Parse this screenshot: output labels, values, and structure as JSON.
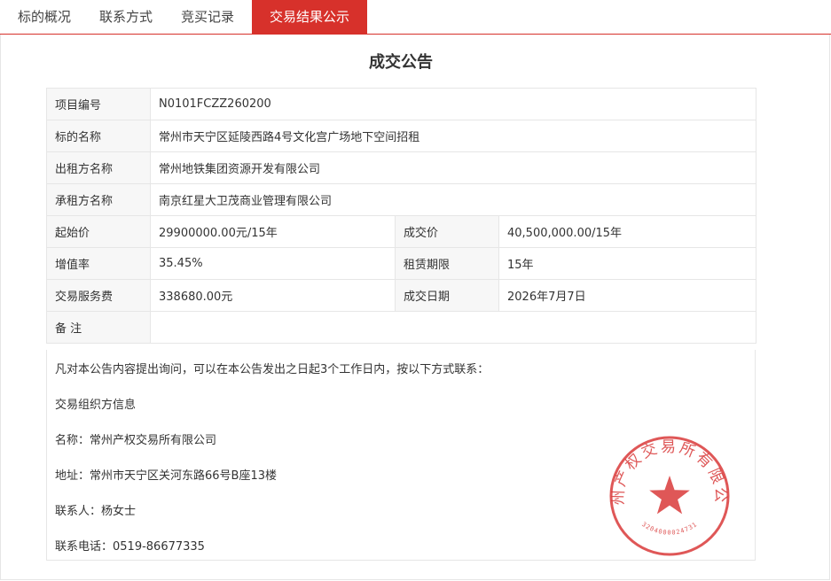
{
  "tabs": [
    {
      "label": "标的概况",
      "active": false
    },
    {
      "label": "联系方式",
      "active": false
    },
    {
      "label": "竞买记录",
      "active": false
    },
    {
      "label": "交易结果公示",
      "active": true
    }
  ],
  "announcement": {
    "title": "成交公告",
    "fields": {
      "project_no_label": "项目编号",
      "project_no": "N0101FCZZ260200",
      "subject_name_label": "标的名称",
      "subject_name": "常州市天宁区延陵西路4号文化宫广场地下空间招租",
      "lessor_label": "出租方名称",
      "lessor": "常州地铁集团资源开发有限公司",
      "lessee_label": "承租方名称",
      "lessee": "南京红星大卫茂商业管理有限公司",
      "start_price_label": "起始价",
      "start_price": "29900000.00元/15年",
      "deal_price_label": "成交价",
      "deal_price": "40,500,000.00/15年",
      "premium_rate_label": "增值率",
      "premium_rate": "35.45%",
      "lease_term_label": "租赁期限",
      "lease_term": "15年",
      "service_fee_label": "交易服务费",
      "service_fee": "338680.00元",
      "deal_date_label": "成交日期",
      "deal_date": "2026年7月7日",
      "remark_label": "备 注",
      "remark": ""
    },
    "notice": {
      "intro": "凡对本公告内容提出询问，可以在本公告发出之日起3个工作日内，按以下方式联系：",
      "organizer": "交易组织方信息",
      "name": "名称：常州产权交易所有限公司",
      "address": "地址：常州市天宁区关河东路66号B座13楼",
      "contact": "联系人：杨女士",
      "phone": "联系电话：0519-86677335"
    },
    "seal": {
      "text": "常州产权交易所有限公司",
      "code": "3204000024731",
      "color": "#d93a3a"
    }
  },
  "colors": {
    "accent": "#d7312b",
    "label_bg": "#f7f7f7",
    "border": "#e6e6e6"
  }
}
